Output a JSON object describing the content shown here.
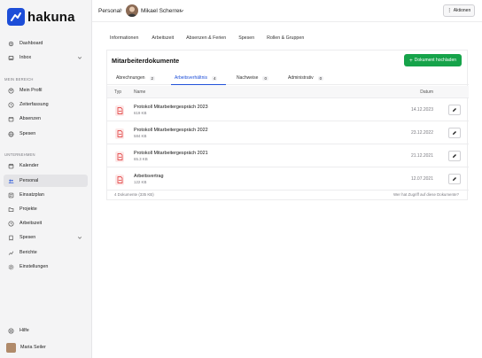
{
  "app": {
    "name": "hakuna",
    "brand_color": "#1d4ed8"
  },
  "sidebar": {
    "top_items": [
      {
        "label": "Dashboard",
        "icon": "gear-icon"
      },
      {
        "label": "Inbox",
        "icon": "inbox-icon"
      }
    ],
    "section_personal": "MEIN BEREICH",
    "personal_items": [
      {
        "label": "Mein Profil",
        "icon": "user-icon"
      },
      {
        "label": "Zeiterfassung",
        "icon": "clock-icon"
      },
      {
        "label": "Absenzen",
        "icon": "calendar-off-icon"
      },
      {
        "label": "Spesen",
        "icon": "globe-icon"
      }
    ],
    "section_company": "UNTERNEHMEN",
    "company_items": [
      {
        "label": "Kalender",
        "icon": "calendar-icon"
      },
      {
        "label": "Personal",
        "icon": "users-icon",
        "active": true
      },
      {
        "label": "Einsatzplan",
        "icon": "plan-icon"
      },
      {
        "label": "Projekte",
        "icon": "folder-icon"
      },
      {
        "label": "Arbeitszeit",
        "icon": "clock-icon"
      },
      {
        "label": "Spesen",
        "icon": "receipt-icon"
      },
      {
        "label": "Berichte",
        "icon": "chart-icon"
      },
      {
        "label": "Einstellungen",
        "icon": "settings-icon"
      }
    ],
    "help_label": "Hilfe",
    "user_name": "Maria Seiler"
  },
  "header": {
    "breadcrumb_root": "Personal",
    "breadcrumb_sep": "›",
    "person_name": "Mikael Scherrer",
    "actions_label": "Aktionen"
  },
  "tabs": [
    "Informationen",
    "Arbeitszeit",
    "Absenzen & Ferien",
    "Spesen",
    "Rollen & Gruppen"
  ],
  "documents": {
    "title": "Mitarbeiterdokumente",
    "upload_label": "Dokument hochladen",
    "subtabs": [
      {
        "label": "Abrechnungen",
        "count": "2"
      },
      {
        "label": "Arbeitsverhältnis",
        "count": "4",
        "active": true
      },
      {
        "label": "Nachweise",
        "count": "0"
      },
      {
        "label": "Administrativ",
        "count": "0"
      }
    ],
    "columns": {
      "type": "Typ",
      "name": "Name",
      "date": "Datum"
    },
    "rows": [
      {
        "name": "Protokoll Mitarbeitergespräch 2023",
        "size": "619 KB",
        "date": "14.12.2023"
      },
      {
        "name": "Protokoll Mitarbeitergespräch 2022",
        "size": "584 KB",
        "date": "23.12.2022"
      },
      {
        "name": "Protokoll Mitarbeitergespräch 2021",
        "size": "65.3 KB",
        "date": "21.12.2021"
      },
      {
        "name": "Arbeitsvertrag",
        "size": "122 KB",
        "date": "12.07.2021"
      }
    ],
    "footer_left": "4 Dokumente (335 KB)",
    "footer_right": "Wer hat Zugriff auf diese Dokumente?"
  }
}
